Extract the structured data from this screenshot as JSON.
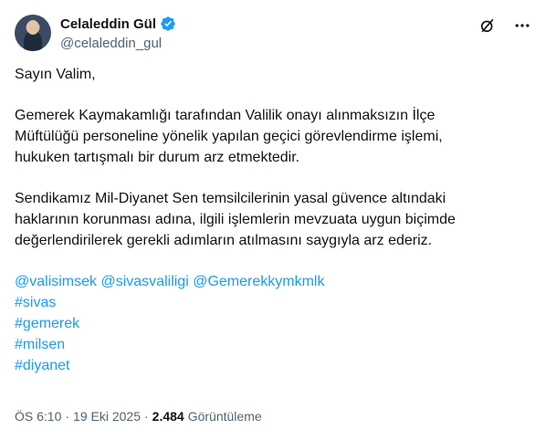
{
  "author": {
    "name": "Celaleddin Gül",
    "handle": "@celaleddin_gul"
  },
  "icons": [
    "verified-icon",
    "grok-icon",
    "more-icon"
  ],
  "colors": {
    "link": "#1d9bf0",
    "secondary": "#536471",
    "verified": "#1d9bf0"
  },
  "tweet": {
    "greeting": "Sayın Valim,",
    "para1": "Gemerek Kaymakamlığı tarafından Valilik onayı alınmaksızın İlçe\nMüftülüğü personeline yönelik yapılan geçici görevlendirme işlemi,\nhukuken tartışmalı bir durum arz etmektedir.",
    "para2": "Sendikamız Mil-Diyanet Sen temsilcilerinin yasal güvence altındaki\nhaklarının korunması adına, ilgili işlemlerin mevzuata uygun biçimde\ndeğerlendirilerek gerekli adımların atılmasını saygıyla arz ederiz.",
    "mentions": [
      "@valisimsek",
      "@sivasvaliligi",
      "@Gemerekkymkmlk"
    ],
    "hashtags": [
      "#sivas",
      "#gemerek",
      "#milsen",
      "#diyanet"
    ]
  },
  "meta": {
    "time": "ÖS 6:10",
    "sep1": "·",
    "date": "19 Eki 2025",
    "sep2": "·",
    "views": "2.484",
    "views_label": "Görüntüleme"
  }
}
